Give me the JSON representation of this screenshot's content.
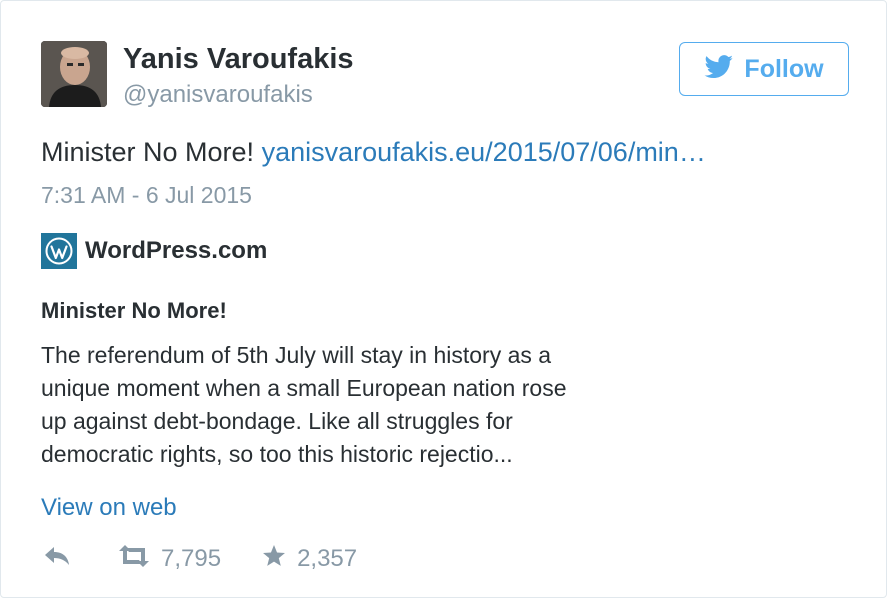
{
  "author": {
    "name": "Yanis Varoufakis",
    "handle": "@yanisvaroufakis"
  },
  "follow_button": {
    "label": "Follow"
  },
  "tweet": {
    "text": "Minister No More!",
    "link": "yanisvaroufakis.eu/2015/07/06/min…",
    "timestamp": "7:31 AM - 6 Jul 2015"
  },
  "card": {
    "source": "WordPress.com",
    "title": "Minister No More!",
    "lines": [
      "The referendum of 5th July will stay in history as a",
      "unique moment when a small European nation rose",
      "up against debt-bondage. Like all struggles for",
      "democratic rights, so too this historic rejectio..."
    ],
    "view_link": "View on web"
  },
  "actions": {
    "retweets": "7,795",
    "favorites": "2,357"
  },
  "colors": {
    "twitter_blue": "#55acee",
    "link_blue": "#2b7bb9",
    "wordpress_blue": "#21759b",
    "muted_gray": "#8899a6"
  }
}
